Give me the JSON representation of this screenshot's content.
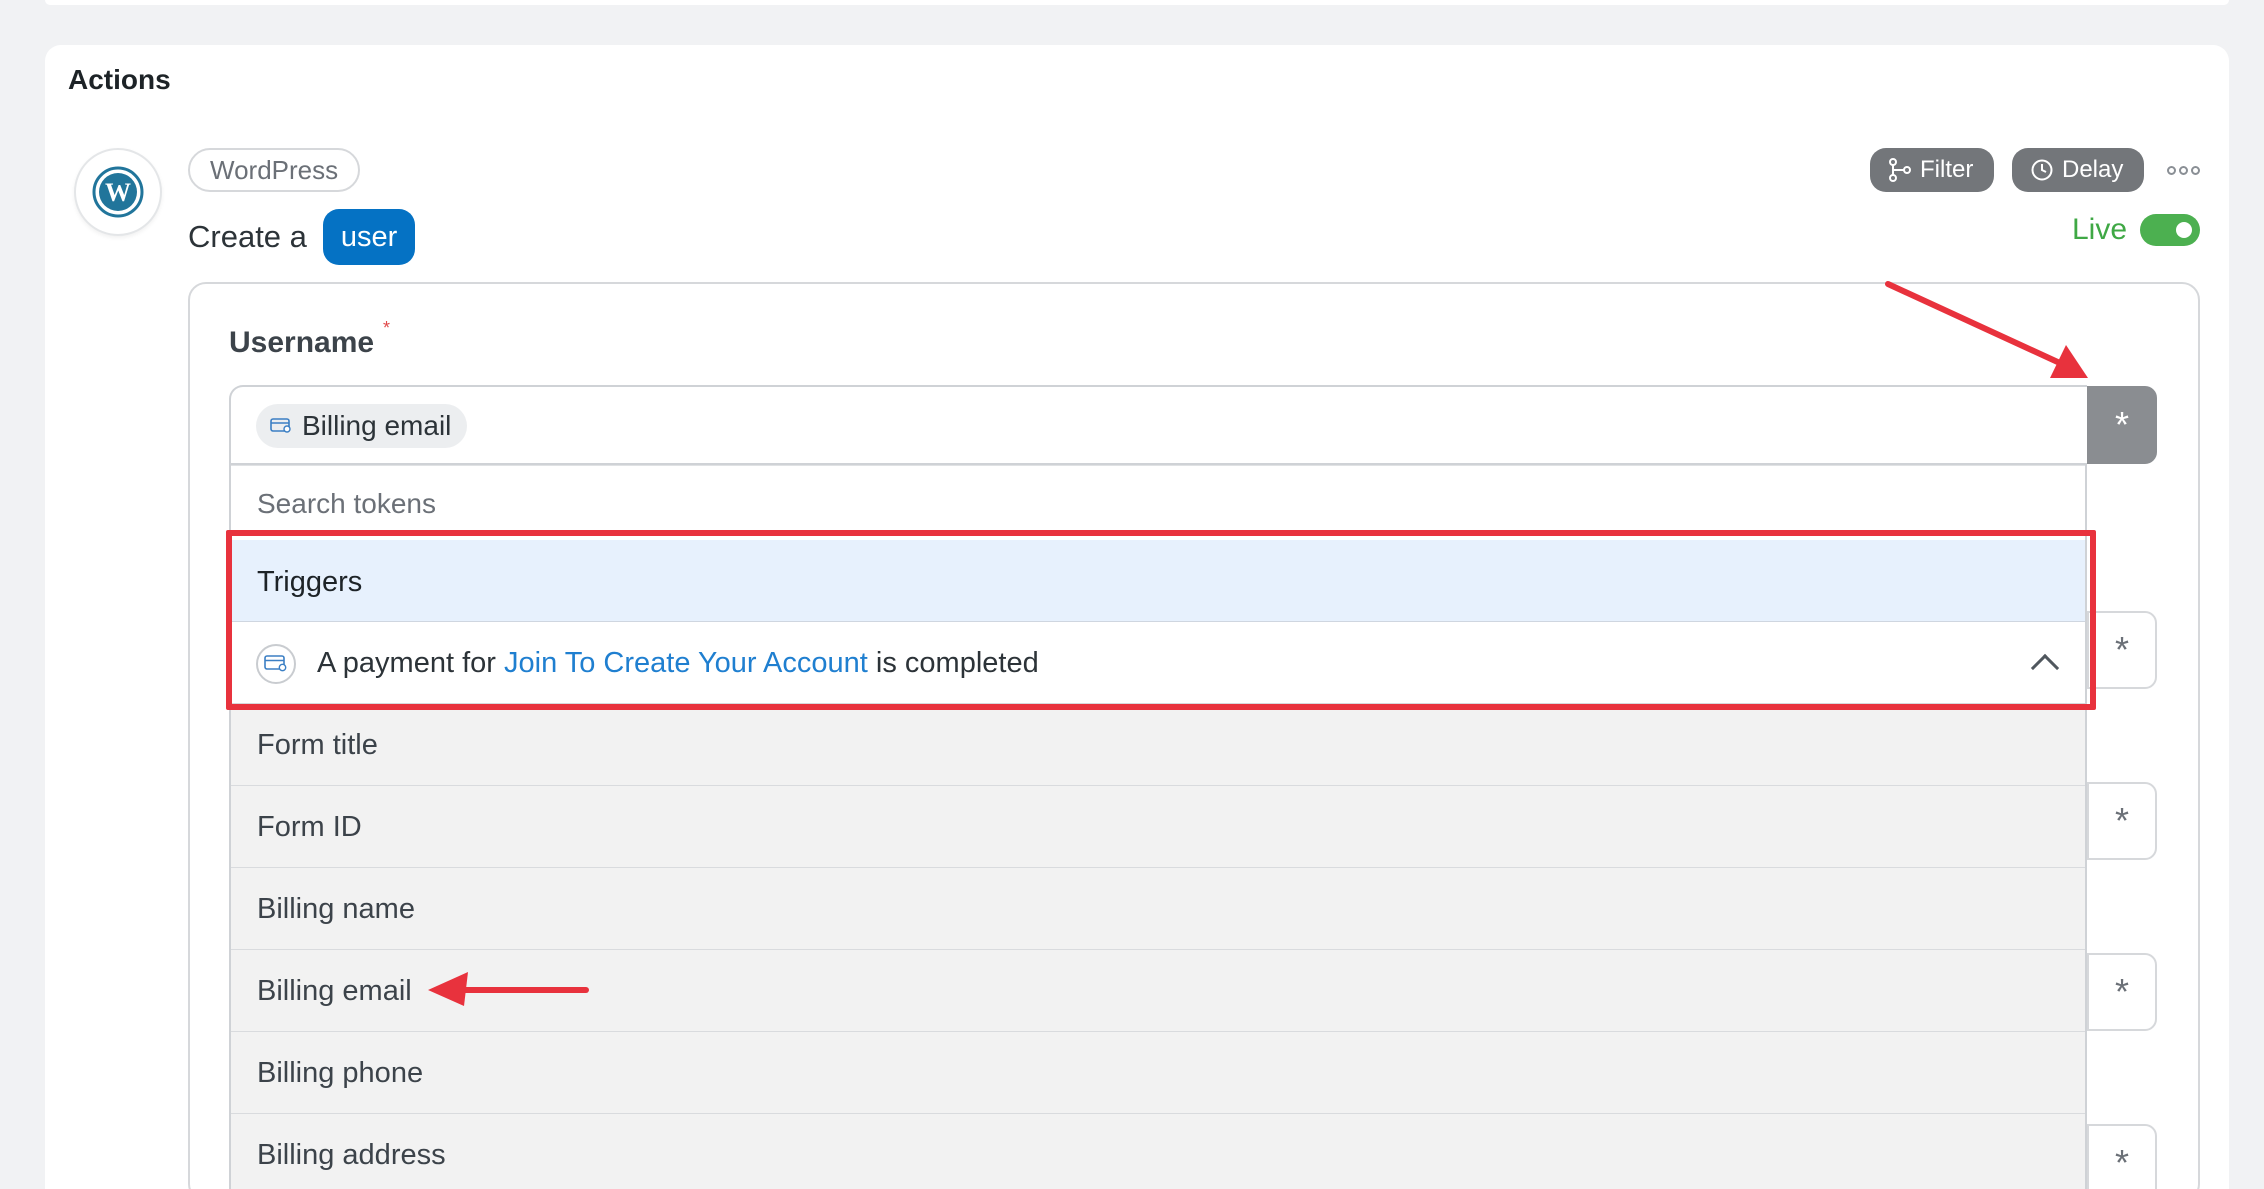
{
  "section": {
    "title": "Actions"
  },
  "action": {
    "integration": "WordPress",
    "sentence_prefix": "Create a",
    "object": "user",
    "filter_label": "Filter",
    "delay_label": "Delay",
    "status_label": "Live",
    "status_on": true
  },
  "field": {
    "label": "Username",
    "required_mark": "*",
    "token_value": "Billing email",
    "asterisk": "*"
  },
  "dropdown": {
    "search_placeholder": "Search tokens",
    "group_label": "Triggers",
    "trigger": {
      "prefix": "A payment for",
      "link": "Join To Create Your Account",
      "suffix": "is completed"
    },
    "tokens": [
      "Form title",
      "Form ID",
      "Billing name",
      "Billing email",
      "Billing phone",
      "Billing address"
    ]
  },
  "colors": {
    "accent": "#0572c4",
    "live": "#4cb050",
    "annotation": "#e8323d",
    "link": "#1f7fd0"
  }
}
